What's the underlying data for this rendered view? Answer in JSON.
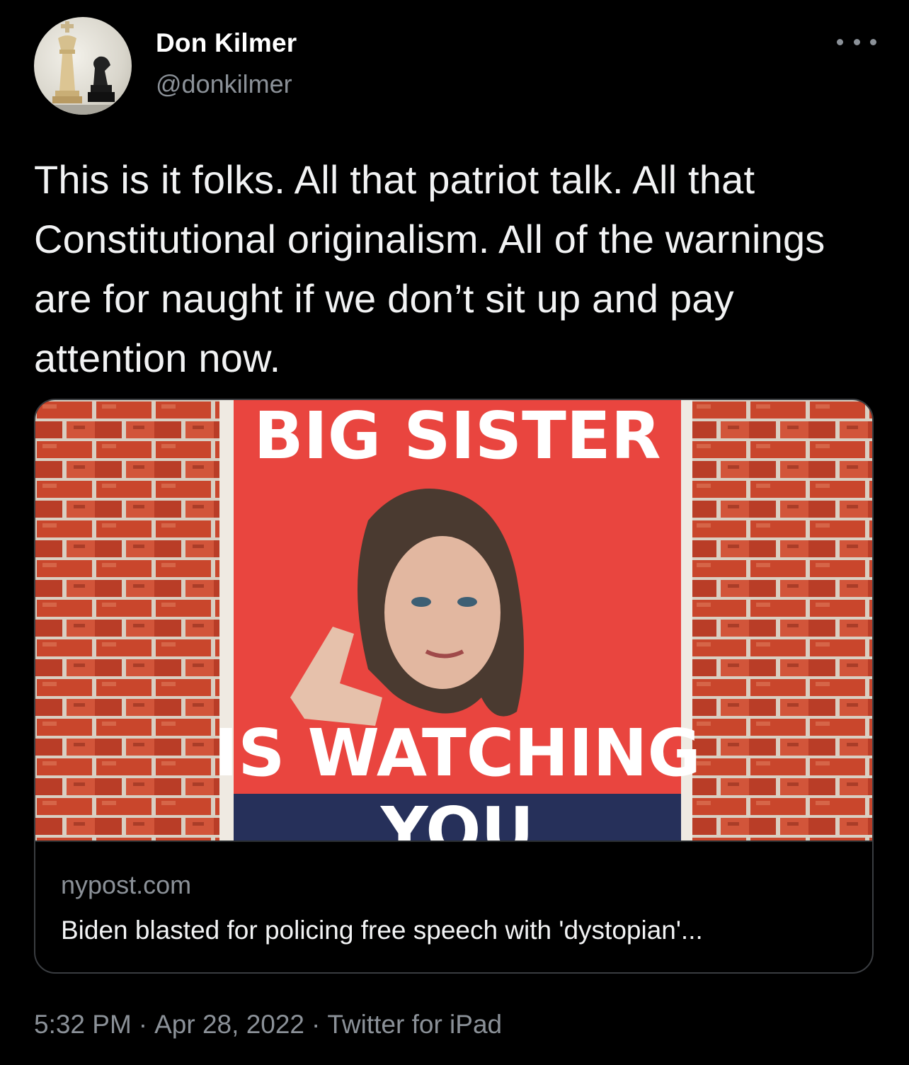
{
  "user": {
    "display_name": "Don Kilmer",
    "handle": "@donkilmer",
    "avatar_icon": "chess-pieces-avatar"
  },
  "more_icon": "more-horizontal-icon",
  "tweet": {
    "text": "This is it folks. All that patriot talk. All that Constitutional originalism. All of the warnings are for naught if we don’t sit up and pay attention now."
  },
  "card": {
    "image": {
      "headline_top": "BIG SISTER",
      "headline_middle": "IS WATCHING",
      "headline_bottom": "YOU"
    },
    "domain": "nypost.com",
    "title": "Biden blasted for policing free speech with 'dystopian'..."
  },
  "meta": {
    "time": "5:32 PM",
    "separator": "·",
    "date": "Apr 28, 2022",
    "source": "Twitter for iPad"
  },
  "colors": {
    "background": "#000000",
    "text": "#e7e9ea",
    "secondary": "#8b9198",
    "border": "#3a3d41",
    "poster_red": "#e9453f",
    "poster_navy": "#26305a",
    "brick": "#c9462c"
  }
}
